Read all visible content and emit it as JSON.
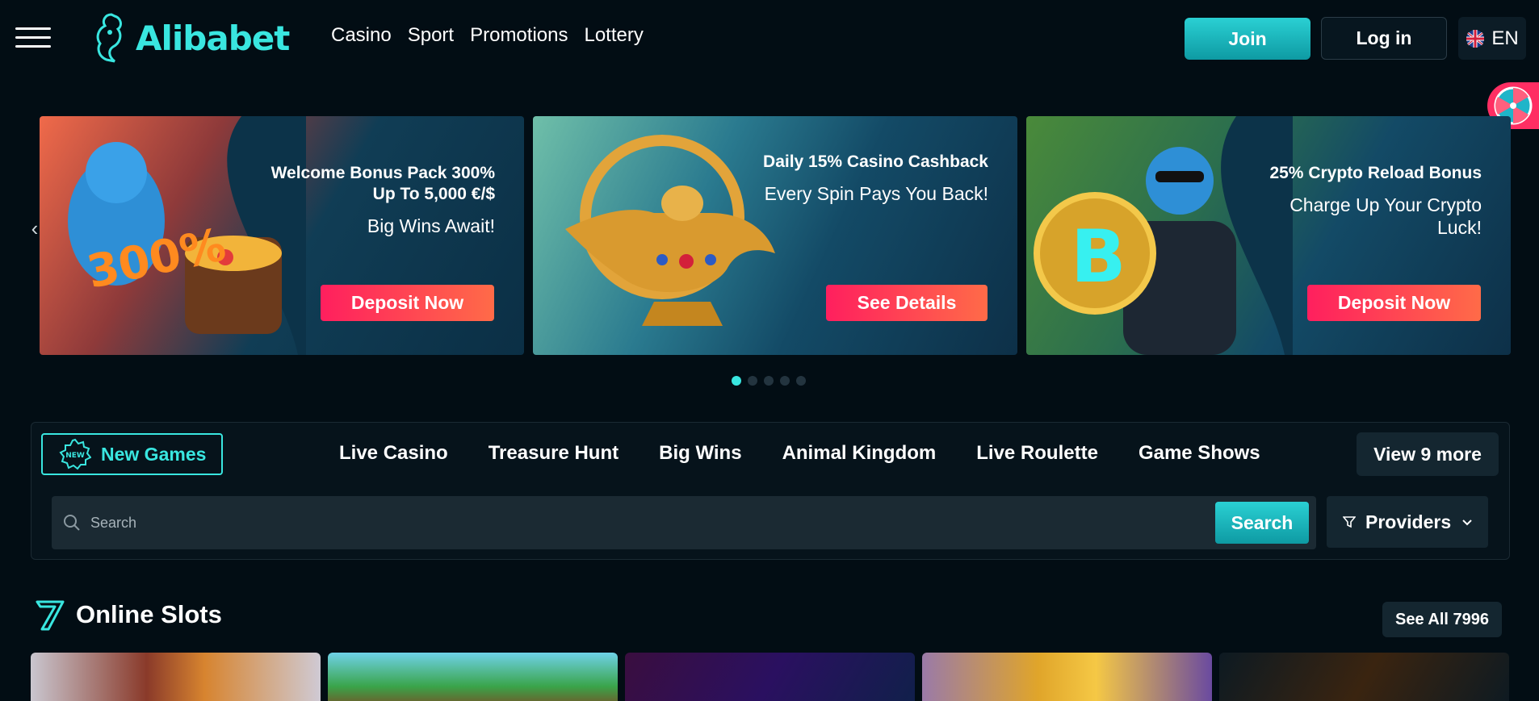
{
  "header": {
    "logo_text": "Alibabet",
    "nav": [
      "Casino",
      "Sport",
      "Promotions",
      "Lottery"
    ],
    "join_label": "Join",
    "login_label": "Log in",
    "language": "EN"
  },
  "banners": [
    {
      "title": "Welcome Bonus Pack 300% Up To 5,000 €/$",
      "subtitle": "Big Wins Await!",
      "cta": "Deposit Now",
      "art_text": "300%"
    },
    {
      "title": "Daily 15% Casino Cashback",
      "subtitle": "Every Spin Pays You Back!",
      "cta": "See Details"
    },
    {
      "title": "25% Crypto Reload Bonus",
      "subtitle": "Charge Up Your Crypto Luck!",
      "cta": "Deposit Now"
    }
  ],
  "carousel": {
    "active_index": 0,
    "total": 5
  },
  "categories": {
    "active": "New Games",
    "items": [
      "Live Casino",
      "Treasure Hunt",
      "Big Wins",
      "Animal Kingdom",
      "Live Roulette",
      "Game Shows"
    ],
    "more_label": "View 9 more"
  },
  "search": {
    "placeholder": "Search",
    "button_label": "Search",
    "providers_label": "Providers"
  },
  "slots": {
    "title": "Online Slots",
    "see_all_label": "See All 7996"
  },
  "colors": {
    "accent": "#39e6e0",
    "cta": "#ff1f5e",
    "background": "#020d14"
  },
  "icons": [
    "menu-icon",
    "genie-logo-icon",
    "uk-flag-icon",
    "fortune-wheel-icon",
    "chevron-left-icon",
    "chevron-right-icon",
    "new-badge-icon",
    "search-icon",
    "filter-icon",
    "chevron-down-icon",
    "seven-icon"
  ]
}
